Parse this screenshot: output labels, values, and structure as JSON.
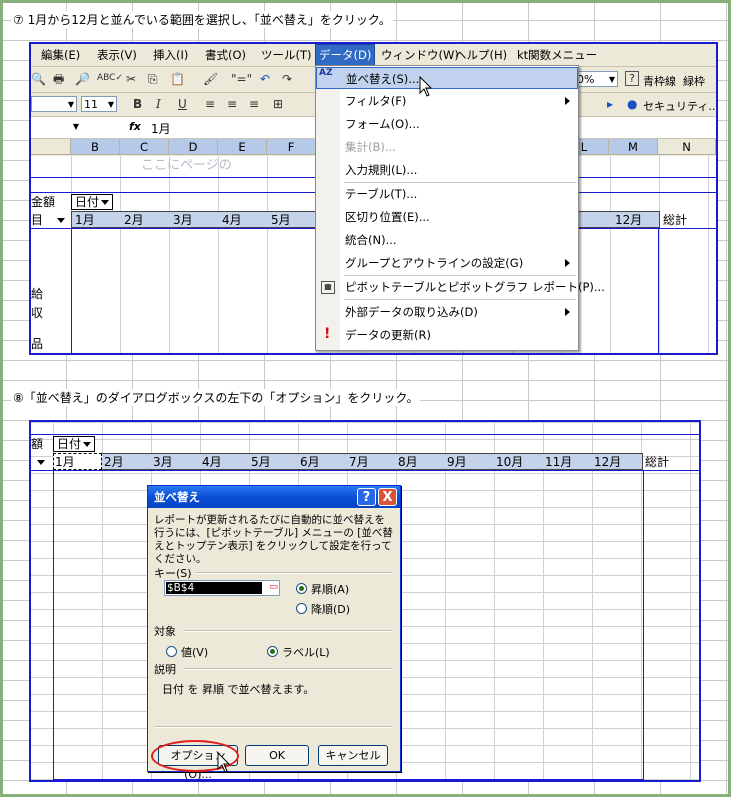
{
  "step7": {
    "text": "⑦ 1月から12月と並んでいる範囲を選択し、「並べ替え」をクリック。"
  },
  "step8": {
    "text": "⑧「並べ替え」のダイアログボックスの左下の「オプション」をクリック。"
  },
  "menubar": {
    "items": [
      "編集(E)",
      "表示(V)",
      "挿入(I)",
      "書式(O)",
      "ツール(T)",
      "データ(D)",
      "ウィンドウ(W)",
      "ヘルプ(H)",
      "kt関数メニュー"
    ],
    "active": "データ(D)"
  },
  "toolbar": {
    "font_size": "11",
    "zoom": "0%",
    "help_label": "?",
    "frame_labels": [
      "青枠線",
      "緑枠"
    ],
    "security_label": "セキュリティ...",
    "bold": "B",
    "italic": "I",
    "underline": "U"
  },
  "formula_bar": {
    "fx": "fx",
    "value": "1月"
  },
  "columns_top": [
    "B",
    "C",
    "D",
    "E",
    "F",
    "L",
    "M",
    "N"
  ],
  "sheet_top": {
    "header_placeholder": "ここにページの",
    "left_label_amount": "金額",
    "left_label_item": "目",
    "date_field": "日付",
    "months_left": [
      "1月",
      "2月",
      "3月",
      "4月",
      "5月"
    ],
    "month_right": "12月",
    "total": "総計",
    "side_chars": [
      "給",
      "収",
      "品"
    ]
  },
  "data_menu": {
    "items": [
      {
        "label": "並べ替え(S)...",
        "state": "highlighted"
      },
      {
        "label": "フィルタ(F)",
        "submenu": true
      },
      {
        "label": "フォーム(O)..."
      },
      {
        "label": "集計(B)...",
        "state": "disabled"
      },
      {
        "label": "入力規則(L)..."
      },
      {
        "label": "テーブル(T)..."
      },
      {
        "label": "区切り位置(E)..."
      },
      {
        "label": "統合(N)..."
      },
      {
        "label": "グループとアウトラインの設定(G)",
        "submenu": true
      },
      {
        "label": "ピボットテーブルとピボットグラフ レポート(P)..."
      },
      {
        "label": "外部データの取り込み(D)",
        "submenu": true
      },
      {
        "label": "データの更新(R)"
      }
    ],
    "sort_icon": "AZ",
    "refresh_icon": "!"
  },
  "sheet_bottom": {
    "left_label": "額",
    "date_field": "日付",
    "months": [
      "1月",
      "2月",
      "3月",
      "4月",
      "5月",
      "6月",
      "7月",
      "8月",
      "9月",
      "10月",
      "11月",
      "12月"
    ],
    "total": "総計"
  },
  "sort_dialog": {
    "title": "並べ替え",
    "help_button": "?",
    "close_button": "X",
    "description": "レポートが更新されるたびに自動的に並べ替えを行うには、[ピボットテーブル] メニューの [並べ替えとトップテン表示] をクリックして設定を行ってください。",
    "key_label": "キー(S)",
    "key_value": "$B$4",
    "ascending": "昇順(A)",
    "descending": "降順(D)",
    "target_label": "対象",
    "target_value": "値(V)",
    "target_label_option": "ラベル(L)",
    "explanation_label": "説明",
    "explanation_text": "日付 を 昇順 で並べ替えます。",
    "options_button": "オプション(O)...",
    "ok_button": "OK",
    "cancel_button": "キャンセル"
  },
  "colors": {
    "frame": "#88b07a",
    "highlight_box": "#1a1acf",
    "title_bar": "#0a4fd6",
    "oval": "#e02020"
  }
}
